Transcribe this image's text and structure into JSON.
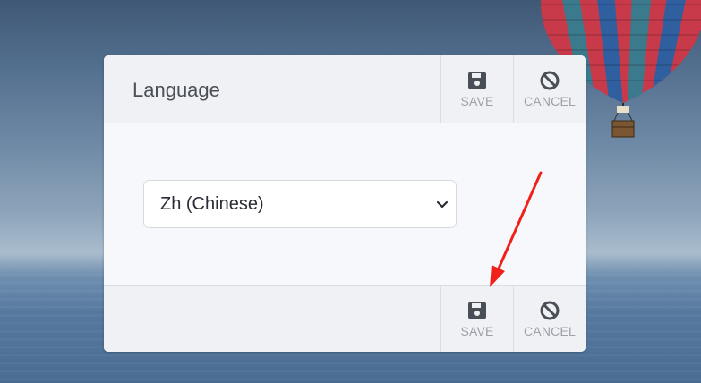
{
  "dialog": {
    "title": "Language",
    "header_buttons": {
      "save": "SAVE",
      "cancel": "CANCEL"
    },
    "footer_buttons": {
      "save": "SAVE",
      "cancel": "CANCEL"
    },
    "language_select": {
      "selected": "Zh (Chinese)"
    }
  },
  "icons": {
    "save": "floppy-disk-icon",
    "cancel": "ban-icon",
    "dropdown": "chevron-down-icon",
    "annotation": "red-arrow"
  },
  "colors": {
    "icon_dark": "#4a4e57",
    "label_gray": "#9ca0a8",
    "annotation_red": "#f0211a"
  }
}
